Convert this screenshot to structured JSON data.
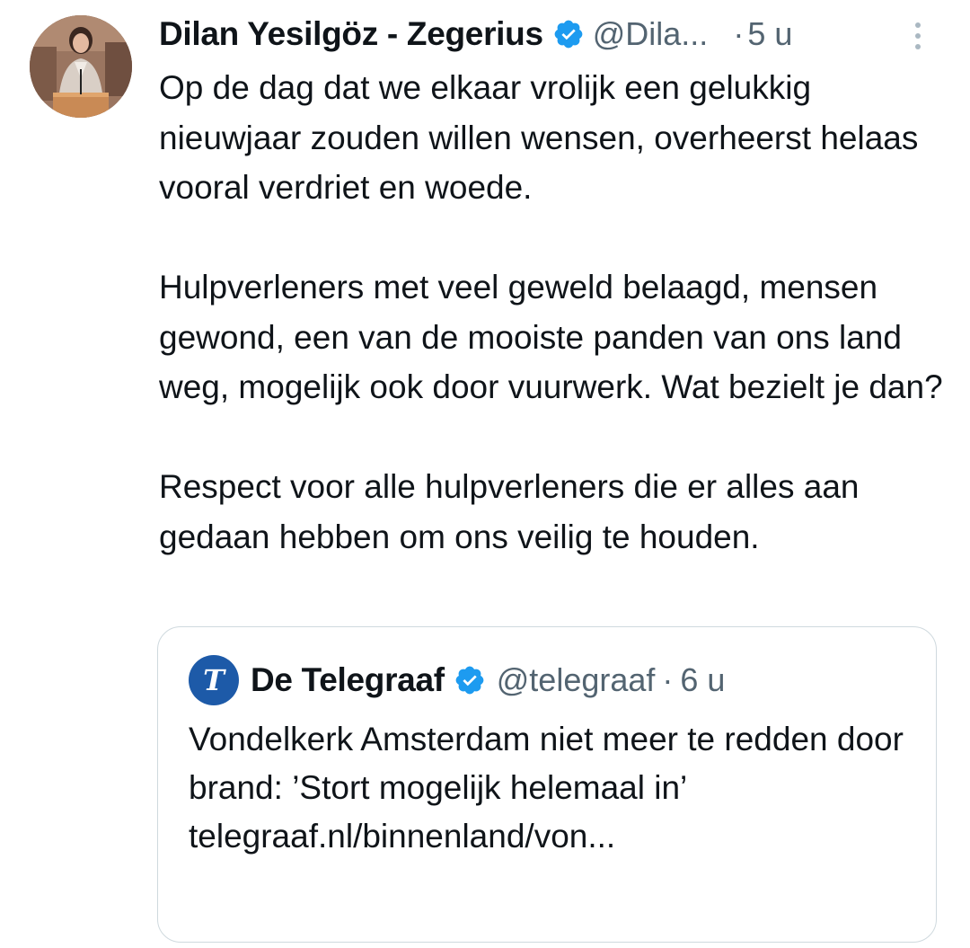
{
  "tweet": {
    "author_name": "Dilan Yesilgöz - Zegerius",
    "handle": "@Dila...",
    "separator": "·",
    "time": "5 u",
    "paragraphs": [
      "Op de dag dat we elkaar vrolijk een gelukkig nieuwjaar zouden willen wensen, overheerst helaas vooral verdriet en woede.",
      "Hulpverleners met veel geweld belaagd, mensen gewond, een van de mooiste panden van ons land weg, mogelijk ook door vuurwerk. Wat bezielt je dan?",
      "Respect voor alle hulpverleners die er alles aan gedaan hebben om ons veilig te houden."
    ]
  },
  "quoted": {
    "avatar_letter": "T",
    "author_name": "De Telegraaf",
    "handle": "@telegraaf",
    "separator": "·",
    "time": "6 u",
    "text": "Vondelkerk Amsterdam niet meer te redden door brand: ’Stort mogelijk helemaal in’ telegraaf.nl/binnenland/von..."
  },
  "colors": {
    "verified": "#1d9bf0",
    "secondary_text": "#536471",
    "border": "#cfd9de",
    "telegraaf_blue": "#1d5aa8"
  },
  "icons": {
    "verified": "verified-badge-icon",
    "more": "more-vertical-icon"
  }
}
